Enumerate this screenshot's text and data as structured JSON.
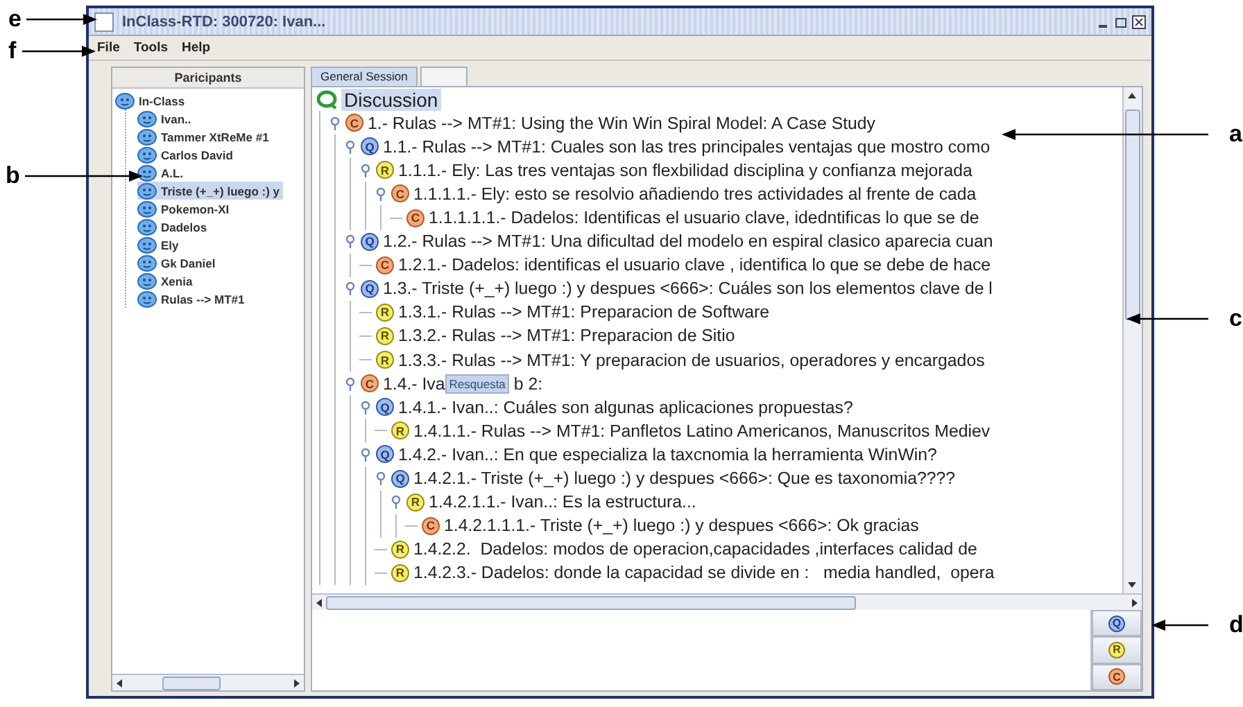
{
  "window": {
    "title": "InClass-RTD: 300720: Ivan..."
  },
  "menu": [
    "File",
    "Tools",
    "Help"
  ],
  "participants": {
    "header": "Paricipants",
    "root": {
      "label": "In-Class",
      "children": [
        {
          "label": "Ivan..",
          "selected": false
        },
        {
          "label": "Tammer XtReMe #1",
          "selected": false
        },
        {
          "label": "Carlos David",
          "selected": false
        },
        {
          "label": "A.L.",
          "selected": false
        },
        {
          "label": "Triste (+_+) luego :) y",
          "selected": true
        },
        {
          "label": "Pokemon-XI",
          "selected": false
        },
        {
          "label": "Dadelos",
          "selected": false
        },
        {
          "label": "Ely",
          "selected": false
        },
        {
          "label": "Gk Daniel",
          "selected": false
        },
        {
          "label": "Xenia",
          "selected": false
        },
        {
          "label": "Rulas --> MT#1",
          "selected": false
        }
      ]
    }
  },
  "tabs": [
    {
      "label": "General Session",
      "selected": true
    },
    {
      "selected": false
    }
  ],
  "discussion": {
    "label": "Discussion",
    "selected": true,
    "children": [
      {
        "kind": "comment",
        "badge": "C",
        "text": "1.- Rulas --> MT#1: Using the Win Win Spiral Model: A Case Study",
        "expanded": true,
        "children": [
          {
            "kind": "question",
            "badge": "Q",
            "text": "1.1.- Rulas --> MT#1: Cuales son las tres principales ventajas que mostro como",
            "expanded": true,
            "children": [
              {
                "kind": "response",
                "badge": "R",
                "text": "1.1.1.- Ely: Las tres ventajas son flexbilidad disciplina y confianza mejorada",
                "expanded": true,
                "children": [
                  {
                    "kind": "comment",
                    "badge": "C",
                    "text": "1.1.1.1.- Ely: esto se resolvio añadiendo tres actividades al frente de cada",
                    "expanded": true,
                    "children": [
                      {
                        "kind": "comment",
                        "badge": "C",
                        "text": "1.1.1.1.1.- Dadelos: Identificas el usuario clave, idedntificas lo que se de"
                      }
                    ]
                  }
                ]
              }
            ]
          },
          {
            "kind": "question",
            "badge": "Q",
            "text": "1.2.- Rulas --> MT#1: Una dificultad del modelo en espiral clasico aparecia cuan",
            "expanded": true,
            "children": [
              {
                "kind": "comment",
                "badge": "C",
                "text": "1.2.1.- Dadelos: identificas el usuario clave , identifica lo que se debe de hace"
              }
            ]
          },
          {
            "kind": "question",
            "badge": "Q",
            "text": "1.3.- Triste (+_+) luego :) y despues <666>: Cuáles son los elementos clave de l",
            "expanded": true,
            "children": [
              {
                "kind": "response",
                "badge": "R",
                "text": "1.3.1.- Rulas --> MT#1: Preparacion de Software"
              },
              {
                "kind": "response",
                "badge": "R",
                "text": "1.3.2.- Rulas --> MT#1: Preparacion de Sitio"
              },
              {
                "kind": "response",
                "badge": "R",
                "text": "1.3.3.- Rulas --> MT#1: Y preparacion de usuarios, operadores y encargados"
              }
            ]
          },
          {
            "kind": "comment",
            "badge": "C",
            "text": "1.4.- Iva",
            "tooltip": "Resquesta",
            "text_after": "b 2:",
            "expanded": true,
            "children": [
              {
                "kind": "question",
                "badge": "Q",
                "text": "1.4.1.- Ivan..: Cuáles son algunas aplicaciones propuestas?",
                "expanded": true,
                "children": [
                  {
                    "kind": "response",
                    "badge": "R",
                    "text": "1.4.1.1.- Rulas --> MT#1: Panfletos Latino Americanos, Manuscritos Mediev"
                  }
                ]
              },
              {
                "kind": "question",
                "badge": "Q",
                "text": "1.4.2.- Ivan..: En que especializa la taxcnomia la herramienta WinWin?",
                "expanded": true,
                "children": [
                  {
                    "kind": "question",
                    "badge": "Q",
                    "text": "1.4.2.1.- Triste (+_+) luego :) y despues <666>: Que es taxonomia????",
                    "expanded": true,
                    "children": [
                      {
                        "kind": "response",
                        "badge": "R",
                        "text": "1.4.2.1.1.- Ivan..: Es la estructura...",
                        "expanded": true,
                        "children": [
                          {
                            "kind": "comment",
                            "badge": "C",
                            "text": "1.4.2.1.1.1.- Triste (+_+) luego :) y despues <666>: Ok gracias"
                          }
                        ]
                      }
                    ]
                  },
                  {
                    "kind": "response",
                    "badge": "R",
                    "text": "1.4.2.2.  Dadelos: modos de operacion,capacidades ,interfaces calidad de"
                  },
                  {
                    "kind": "response",
                    "badge": "R",
                    "text": "1.4.2.3.- Dadelos: donde la capacidad se divide en :   media handled,  opera"
                  }
                ]
              }
            ]
          }
        ]
      }
    ]
  },
  "post_buttons": [
    {
      "kind": "question",
      "badge": "Q"
    },
    {
      "kind": "response",
      "badge": "R"
    },
    {
      "kind": "comment",
      "badge": "C"
    }
  ],
  "annotations": [
    {
      "label": "e"
    },
    {
      "label": "f"
    },
    {
      "label": "b"
    },
    {
      "label": "a"
    },
    {
      "label": "c"
    },
    {
      "label": "d"
    }
  ]
}
